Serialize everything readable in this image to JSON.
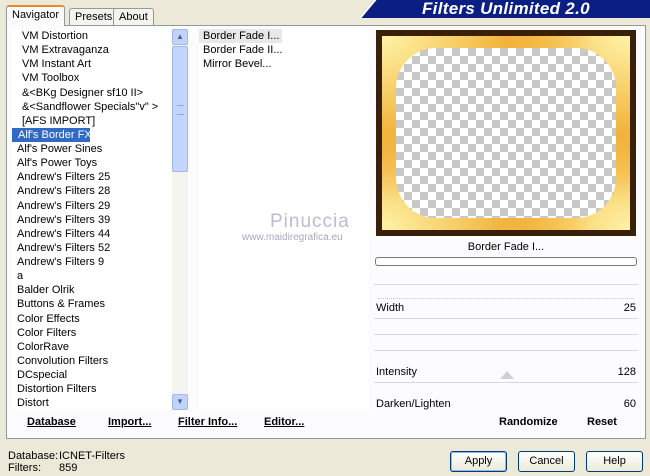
{
  "banner_title": "Filters Unlimited 2.0",
  "tabs": [
    {
      "label": "Navigator"
    },
    {
      "label": "Presets"
    },
    {
      "label": "About"
    }
  ],
  "categories": [
    "VM Distortion",
    "VM Extravaganza",
    "VM Instant Art",
    "VM Toolbox",
    "&<BKg Designer sf10 II>",
    "&<Sandflower Specials\"v\" >",
    "[AFS IMPORT]",
    "Alf's Border FX",
    "Alf's Power Sines",
    "Alf's Power Toys",
    "Andrew's Filters 25",
    "Andrew's Filters 28",
    "Andrew's Filters 29",
    "Andrew's Filters 39",
    "Andrew's Filters 44",
    "Andrew's Filters 52",
    "Andrew's Filters 9",
    "a",
    "Balder Olrik",
    "Buttons & Frames",
    "Color Effects",
    "Color Filters",
    "ColorRave",
    "Convolution Filters",
    "DCspecial",
    "Distortion Filters",
    "Distort"
  ],
  "filters": [
    "Border Fade I...",
    "Border Fade II...",
    "Mirror Bevel..."
  ],
  "left_buttons": {
    "database": "Database",
    "import": "Import...",
    "filter_info": "Filter Info...",
    "editor": "Editor..."
  },
  "watermark": {
    "name": "Pinuccia",
    "url": "www.maidiregrafica.eu"
  },
  "preview_label": "Border Fade I...",
  "params": [
    {
      "label": "Width",
      "value": "25"
    },
    {
      "label": "Intensity",
      "value": "128"
    },
    {
      "label": "Darken/Lighten",
      "value": "60"
    }
  ],
  "right_buttons": {
    "randomize": "Randomize",
    "reset": "Reset"
  },
  "info": {
    "database_label": "Database:",
    "database_value": "ICNET-Filters",
    "filters_label": "Filters:",
    "filters_value": "859"
  },
  "dialog_buttons": {
    "apply": "Apply",
    "cancel": "Cancel",
    "help": "Help"
  }
}
